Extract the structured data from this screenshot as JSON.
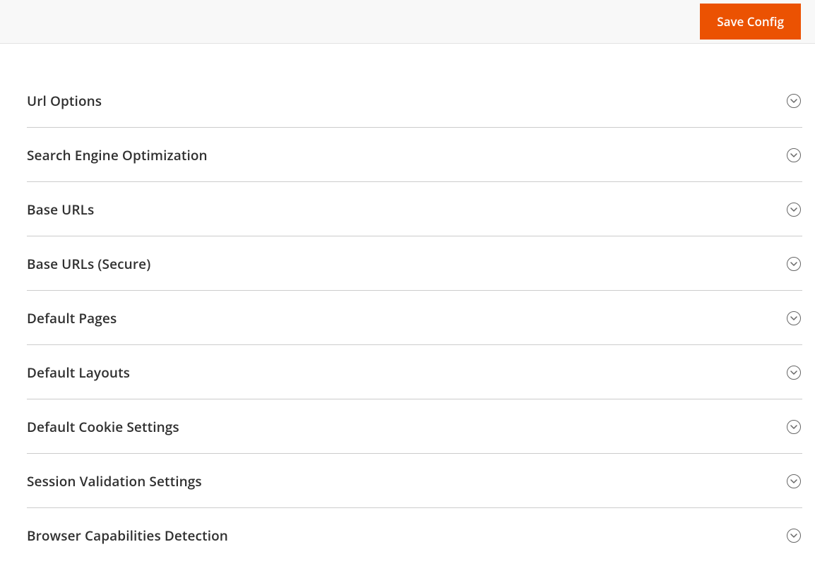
{
  "header": {
    "save_button_label": "Save Config"
  },
  "sections": [
    {
      "title": "Url Options"
    },
    {
      "title": "Search Engine Optimization"
    },
    {
      "title": "Base URLs"
    },
    {
      "title": "Base URLs (Secure)"
    },
    {
      "title": "Default Pages"
    },
    {
      "title": "Default Layouts"
    },
    {
      "title": "Default Cookie Settings"
    },
    {
      "title": "Session Validation Settings"
    },
    {
      "title": "Browser Capabilities Detection"
    }
  ]
}
